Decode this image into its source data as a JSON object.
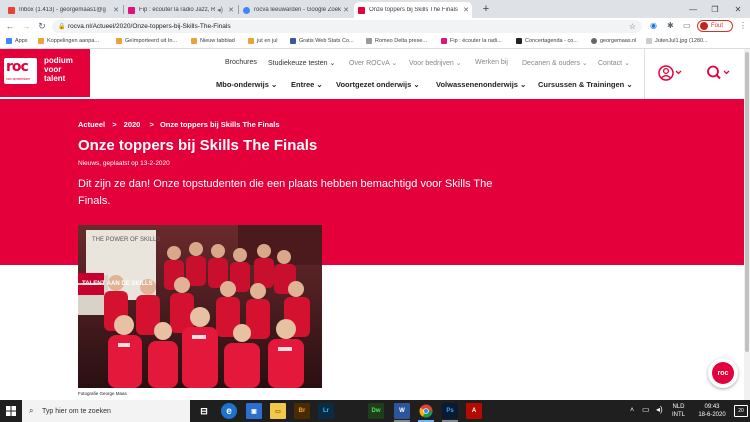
{
  "browser": {
    "tabs": [
      {
        "label": "Inbox (1.413) - georgemaas1@g",
        "favicon_color": "#ea4335"
      },
      {
        "label": "Fip : écouter la radio Jazz, Ro",
        "favicon_color": "#e2127a"
      },
      {
        "label": "rocva leeuwarden - Google Zoek",
        "favicon_color": "#4285f4"
      },
      {
        "label": "Onze toppers bij Skills The Finals",
        "favicon_color": "#e4003a"
      }
    ],
    "new_tab": "+",
    "url": "rocva.nl/Actueel/2020/Onze-toppers-bij-Skills-The-Finals",
    "profile_label": "Fout",
    "bookmarks": [
      {
        "label": "Apps",
        "color": "#4285f4"
      },
      {
        "label": "Koppelingen aanpa...",
        "color": "#e8a33d"
      },
      {
        "label": "Geïmporteerd uit In...",
        "color": "#e8a33d"
      },
      {
        "label": "Nieuw tabblad",
        "color": "#e8a33d"
      },
      {
        "label": "jut en jul",
        "color": "#e8a33d"
      },
      {
        "label": "Gratis Web Stats Co...",
        "color": "#3b5998"
      },
      {
        "label": "Romeo Delta prese...",
        "color": "#999999"
      },
      {
        "label": "Fip : écouter la radi...",
        "color": "#e2127a"
      },
      {
        "label": "Concertagenda - co...",
        "color": "#222222"
      },
      {
        "label": "georgemaas.nl",
        "color": "#666666"
      },
      {
        "label": "JutenJul1.jpg (1280...",
        "color": "#cccccc"
      }
    ]
  },
  "site": {
    "logo_text": "roc",
    "logo_sub": "van amsterdam",
    "logo_tag": [
      "podium",
      "voor",
      "talent"
    ],
    "top_nav": [
      {
        "label": "Brochures",
        "muted": false
      },
      {
        "label": "Studiekeuze testen ⌄",
        "muted": false
      },
      {
        "label": "Over ROCvA ⌄",
        "muted": true
      },
      {
        "label": "Voor bedrijven ⌄",
        "muted": true
      },
      {
        "label": "Werken bij",
        "muted": true
      },
      {
        "label": "Decanen & ouders ⌄",
        "muted": true
      },
      {
        "label": "Contact ⌄",
        "muted": true
      }
    ],
    "main_nav": [
      "Mbo-onderwijs ⌄",
      "Entree ⌄",
      "Voortgezet onderwijs ⌄",
      "Volwassenenonderwijs ⌄",
      "Cursussen & Trainingen ⌄"
    ],
    "brand_color": "#e4003a"
  },
  "article": {
    "breadcrumbs": [
      "Actueel",
      ">",
      "2020",
      ">",
      "Onze toppers bij Skills The Finals"
    ],
    "title": "Onze toppers bij Skills The Finals",
    "meta": "Nieuws, geplaatst op 13-2-2020",
    "lead": "Dit zijn ze dan! Onze topstudenten die een plaats hebben bemachtigd voor Skills The Finals.",
    "photo_banner_text": "THE POWER OF SKILLS",
    "photo_banner_sub": "TALENT AAN DE SKILLS",
    "caption": "Fotografie George Maas",
    "float_logo": "roc"
  },
  "taskbar": {
    "search_placeholder": "Typ hier om te zoeken",
    "apps": [
      {
        "name": "task-view",
        "label": "⊟",
        "color": "#1f1f1f"
      },
      {
        "name": "edge",
        "label": "e",
        "color": "#1e73c8"
      },
      {
        "name": "store",
        "label": "▣",
        "color": "#2b6fd0"
      },
      {
        "name": "explorer",
        "label": "▭",
        "color": "#f3c74b"
      },
      {
        "name": "bridge",
        "label": "Br",
        "color": "#4a2b00"
      },
      {
        "name": "lightroom",
        "label": "Lr",
        "color": "#0b2a44"
      },
      {
        "name": "dreamweaver",
        "label": "Dw",
        "color": "#1d3d1d"
      },
      {
        "name": "word",
        "label": "W",
        "color": "#2b579a"
      },
      {
        "name": "chrome",
        "label": "●",
        "color": "#1f1f1f"
      },
      {
        "name": "photoshop",
        "label": "Ps",
        "color": "#0a1a33"
      },
      {
        "name": "acrobat",
        "label": "A",
        "color": "#b30b00"
      }
    ],
    "lang_top": "NLD",
    "lang_bottom": "INTL",
    "time": "09:43",
    "date": "18-6-2020",
    "notif_count": "20"
  }
}
